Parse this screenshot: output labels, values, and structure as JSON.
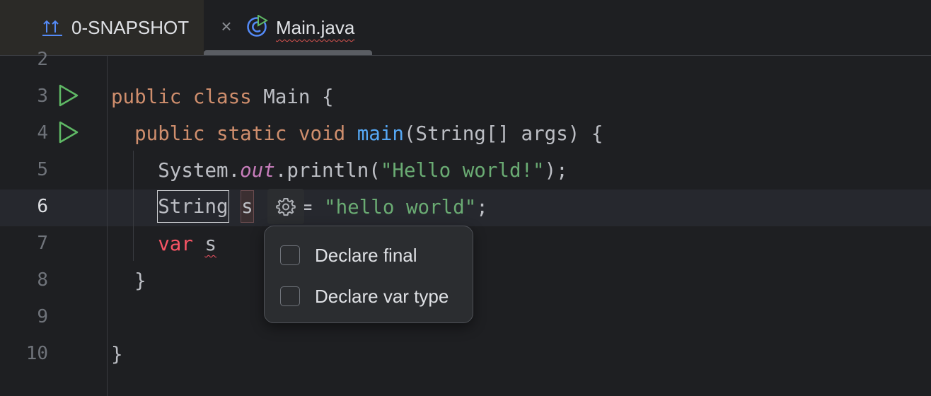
{
  "tabs": {
    "snapshot": {
      "label": "0-SNAPSHOT",
      "icon": "module-icon"
    },
    "close_icon": "close-icon",
    "main": {
      "label": "Main.java",
      "icon": "java-class-icon",
      "active": true
    }
  },
  "editor": {
    "line_numbers": [
      "2",
      "3",
      "4",
      "5",
      "6",
      "7",
      "8",
      "9",
      "10"
    ],
    "current_line": "6",
    "run_icon": "run-icon",
    "code": {
      "l3_kw1": "public",
      "l3_kw2": "class",
      "l3_rest": " Main {",
      "l4_kw1": "public",
      "l4_kw2": "static",
      "l4_kw3": "void",
      "l4_fn": "main",
      "l4_rest": "(String[] args) {",
      "l5_obj": "System.",
      "l5_field": "out",
      "l5_call": ".println(",
      "l5_str": "\"Hello world!\"",
      "l5_end": ");",
      "l6_type": "String",
      "l6_var": "s",
      "l6_eq": " = ",
      "l6_str": "\"hello world\"",
      "l6_end": ";",
      "l7_kw": "var",
      "l7_var": "s",
      "l8": "}",
      "l10": "}"
    },
    "gear_icon": "gear-icon"
  },
  "popup": {
    "options": [
      {
        "label": "Declare final",
        "checked": false
      },
      {
        "label": "Declare var type",
        "checked": false
      }
    ]
  },
  "colors": {
    "background": "#1e1f22",
    "keyword": "#cf8e6d",
    "function": "#56a8f5",
    "string": "#6aab73",
    "static_field": "#c77dbb",
    "error_keyword": "#f75464",
    "run_icon": "#5fb865"
  }
}
